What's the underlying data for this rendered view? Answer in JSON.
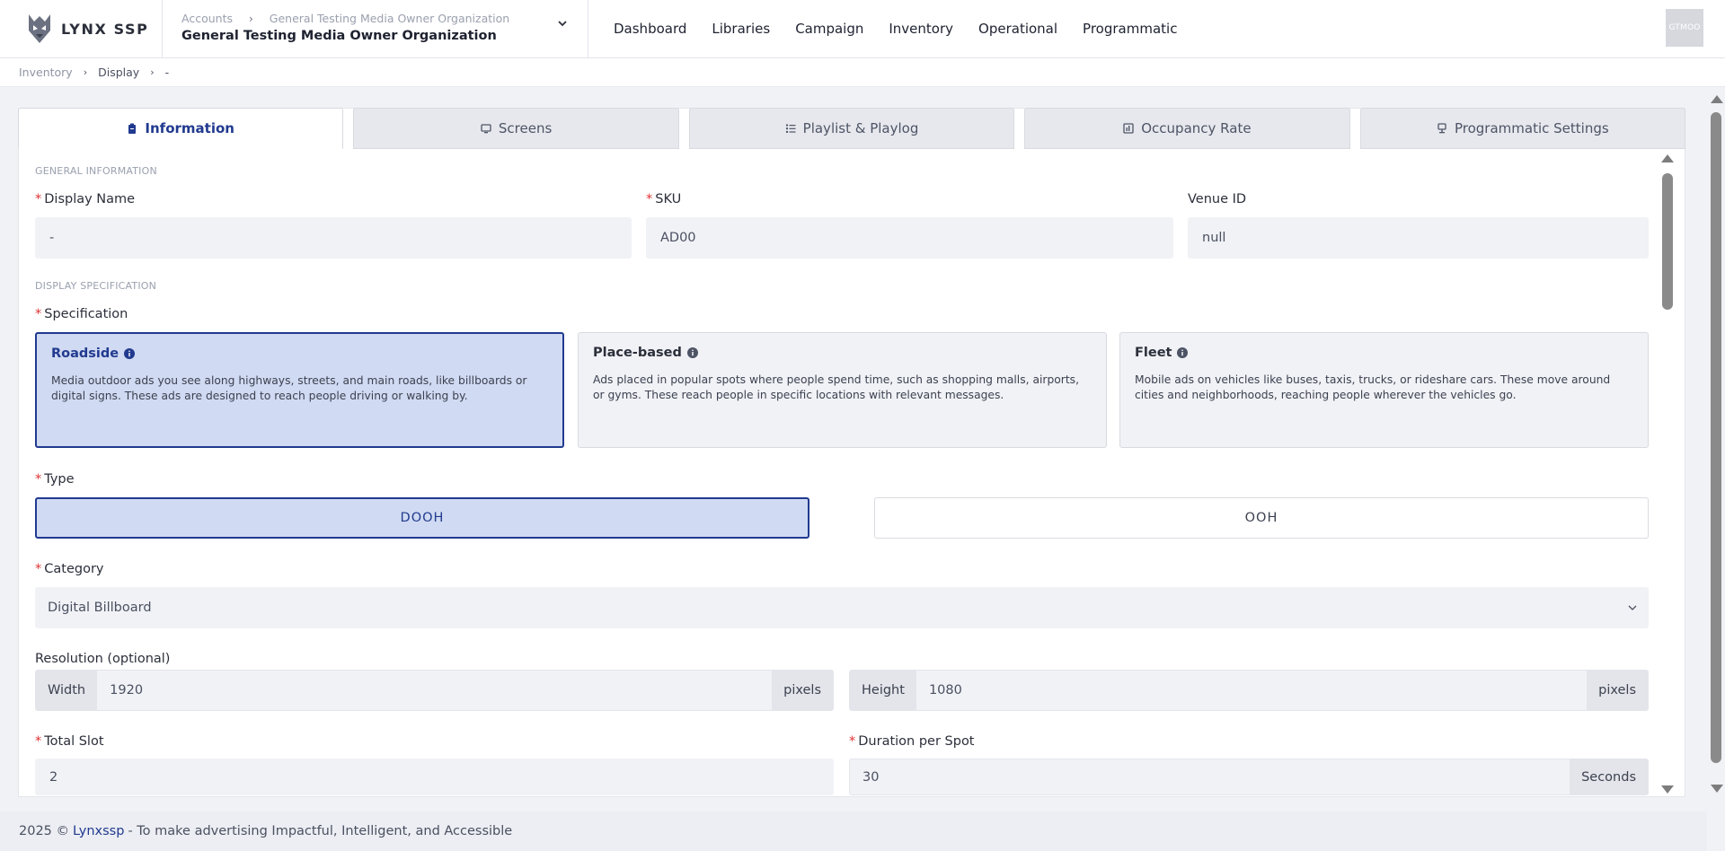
{
  "app": {
    "name": "LYNX SSP"
  },
  "org": {
    "crumb_accounts": "Accounts",
    "crumb_org": "General Testing Media Owner Organization",
    "title": "General Testing Media Owner Organization"
  },
  "nav": {
    "dashboard": "Dashboard",
    "libraries": "Libraries",
    "campaign": "Campaign",
    "inventory": "Inventory",
    "operational": "Operational",
    "programmatic": "Programmatic"
  },
  "user": {
    "avatar_text": "GTMOO"
  },
  "breadcrumb": {
    "inventory": "Inventory",
    "display": "Display",
    "current": "-"
  },
  "tabs": {
    "information": "Information",
    "screens": "Screens",
    "playlist": "Playlist & Playlog",
    "occupancy": "Occupancy Rate",
    "programmatic": "Programmatic Settings"
  },
  "general": {
    "section": "GENERAL INFORMATION",
    "display_name_label": "Display Name",
    "display_name_value": "-",
    "sku_label": "SKU",
    "sku_value": "AD00",
    "venue_label": "Venue ID",
    "venue_value": "null"
  },
  "spec": {
    "section": "DISPLAY SPECIFICATION",
    "label": "Specification",
    "options": [
      {
        "title": "Roadside",
        "desc": "Media outdoor ads you see along highways, streets, and main roads, like billboards or digital signs. These ads are designed to reach people driving or walking by."
      },
      {
        "title": "Place-based",
        "desc": "Ads placed in popular spots where people spend time, such as shopping malls, airports, or gyms. These reach people in specific locations with relevant messages."
      },
      {
        "title": "Fleet",
        "desc": "Mobile ads on vehicles like buses, taxis, trucks, or rideshare cars. These move around cities and neighborhoods, reaching people wherever the vehicles go."
      }
    ],
    "selected": "Roadside"
  },
  "type": {
    "label": "Type",
    "option_dooh": "DOOH",
    "option_ooh": "OOH",
    "selected": "DOOH"
  },
  "category": {
    "label": "Category",
    "value": "Digital Billboard"
  },
  "resolution": {
    "label": "Resolution (optional)",
    "width_label": "Width",
    "width_value": "1920",
    "height_label": "Height",
    "height_value": "1080",
    "unit": "pixels"
  },
  "slot": {
    "label": "Total Slot",
    "value": "2"
  },
  "duration": {
    "label": "Duration per Spot",
    "value": "30",
    "unit": "Seconds"
  },
  "footer": {
    "year": "2025 ©",
    "brand": "Lynxssp",
    "tagline": "- To make advertising Impactful, Intelligent, and Accessible"
  },
  "colors": {
    "accent": "#213a8f",
    "selected_bg": "#d0daf2",
    "required": "#e03131"
  }
}
